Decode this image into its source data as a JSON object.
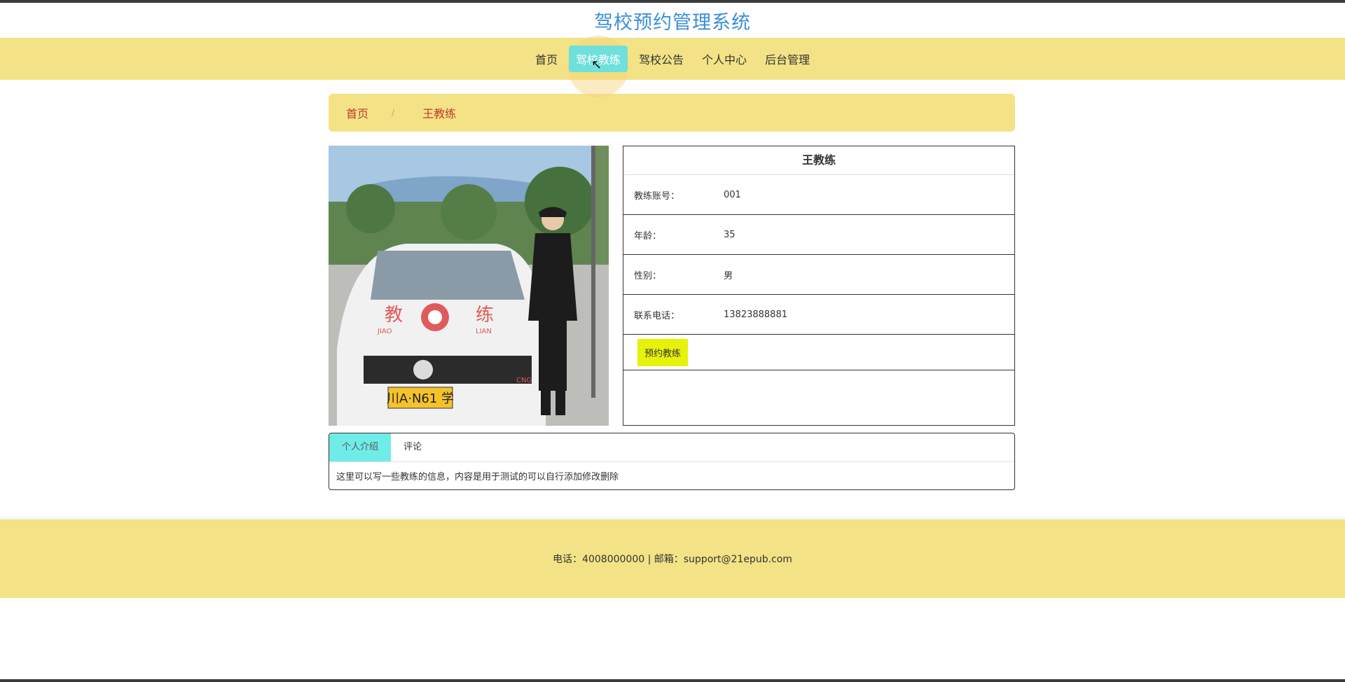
{
  "site": {
    "title": "驾校预约管理系统"
  },
  "nav": {
    "items": [
      {
        "label": "首页"
      },
      {
        "label": "驾校教练"
      },
      {
        "label": "驾校公告"
      },
      {
        "label": "个人中心"
      },
      {
        "label": "后台管理"
      }
    ],
    "active_index": 1
  },
  "breadcrumb": {
    "home": "首页",
    "separator": "/",
    "current": "王教练"
  },
  "coach": {
    "name": "王教练",
    "fields": [
      {
        "label": "教练账号：",
        "value": "001"
      },
      {
        "label": "年龄：",
        "value": "35"
      },
      {
        "label": "性别：",
        "value": "男"
      },
      {
        "label": "联系电话：",
        "value": "13823888881"
      }
    ],
    "book_button": "预约教练"
  },
  "photo": {
    "car_text_cn_left": "教",
    "car_text_cn_right": "练",
    "car_text_py_left": "JIAO",
    "car_text_py_right": "LIAN",
    "plate": "川A·N61 学",
    "cng": "CNG"
  },
  "tabs": {
    "items": [
      {
        "label": "个人介绍"
      },
      {
        "label": "评论"
      }
    ],
    "active_index": 0,
    "content": "这里可以写一些教练的信息，内容是用于测试的可以自行添加修改删除"
  },
  "footer": {
    "text": "电话：4008000000 | 邮箱：support@21epub.com"
  },
  "colors": {
    "accent_yellow": "#f3e386",
    "title_blue": "#3a8fd8",
    "active_cyan": "#6fe0dc",
    "button_yellow": "#e6f20a",
    "breadcrumb_red": "#c0392b"
  }
}
